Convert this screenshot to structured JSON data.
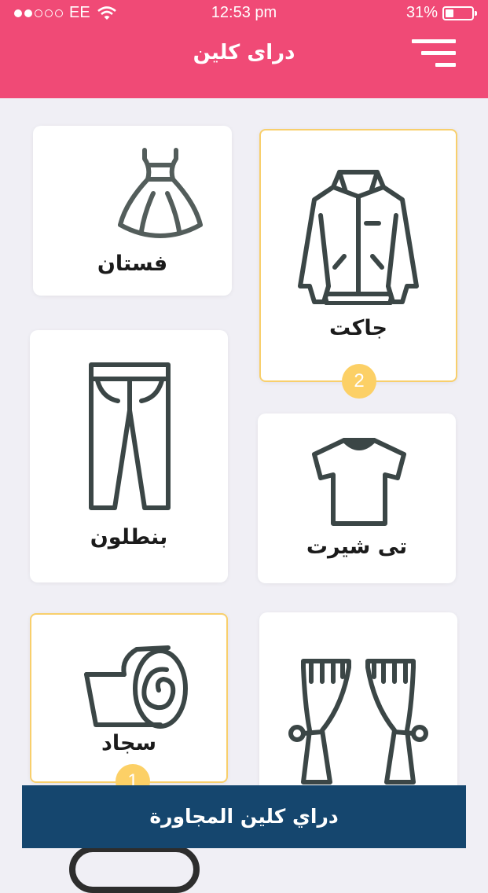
{
  "status_bar": {
    "carrier": "EE",
    "time": "12:53 pm",
    "battery_percent": "31%",
    "battery_level": 0.31
  },
  "header": {
    "title": "دراى كلين",
    "menu_icon": "hamburger-menu-icon"
  },
  "items": [
    {
      "id": "dress",
      "label": "فستان",
      "icon": "dress-icon",
      "selected": false,
      "count": null
    },
    {
      "id": "jacket",
      "label": "جاكت",
      "icon": "jacket-icon",
      "selected": true,
      "count": "2"
    },
    {
      "id": "pants",
      "label": "بنطلون",
      "icon": "pants-icon",
      "selected": false,
      "count": null
    },
    {
      "id": "tshirt",
      "label": "تى شيرت",
      "icon": "tshirt-icon",
      "selected": false,
      "count": null
    },
    {
      "id": "carpet",
      "label": "سجاد",
      "icon": "carpet-roll-icon",
      "selected": true,
      "count": "1"
    },
    {
      "id": "curtains",
      "label": "",
      "icon": "curtains-icon",
      "selected": false,
      "count": null
    }
  ],
  "bottom_button": {
    "label": "دراي كلين المجاورة"
  },
  "colors": {
    "header": "#f04a76",
    "background": "#f0eff5",
    "selected_border": "#f8cf6c",
    "badge": "#fcd066",
    "bottom_bar": "#15466e",
    "icon_stroke": "#3b4646"
  }
}
